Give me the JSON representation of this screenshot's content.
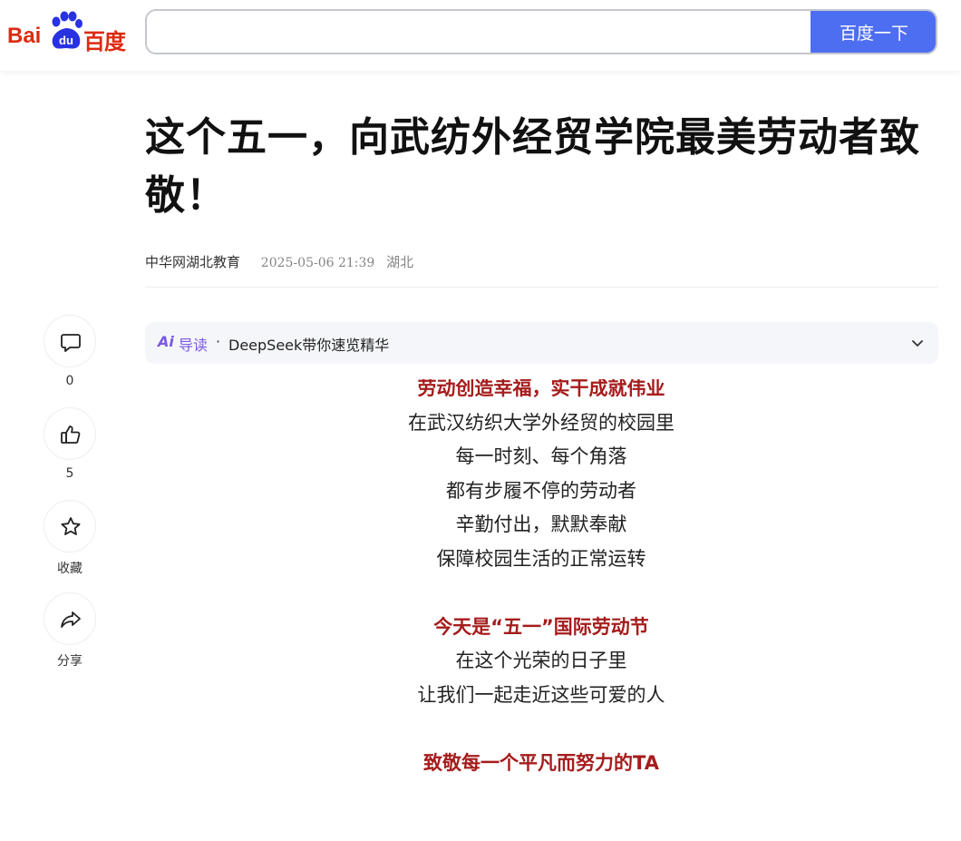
{
  "header": {
    "logo": {
      "text_left": "Bai",
      "text_mid": "du",
      "text_right": "百度"
    },
    "search": {
      "value": "",
      "button_label": "百度一下"
    }
  },
  "article": {
    "title": "这个五一，向武纺外经贸学院最美劳动者致敬！",
    "author": "中华网湖北教育",
    "date": "2025-05-06 21:39",
    "location": "湖北",
    "ai_summary": {
      "logo": "Ai",
      "label": "导读",
      "separator": "·",
      "text": "DeepSeek带你速览精华"
    },
    "lines": [
      {
        "text": "劳动创造幸福，实干成就伟业",
        "style": "red"
      },
      {
        "text": "在武汉纺织大学外经贸的校园里",
        "style": "normal"
      },
      {
        "text": "每一时刻、每个角落",
        "style": "normal"
      },
      {
        "text": "都有步履不停的劳动者",
        "style": "normal"
      },
      {
        "text": "辛勤付出，默默奉献",
        "style": "normal"
      },
      {
        "text": "保障校园生活的正常运转",
        "style": "normal"
      },
      {
        "text": "",
        "style": "blank"
      },
      {
        "text": "今天是“五一”国际劳动节",
        "style": "red"
      },
      {
        "text": "在这个光荣的日子里",
        "style": "normal"
      },
      {
        "text": "让我们一起走近这些可爱的人",
        "style": "normal"
      },
      {
        "text": "",
        "style": "blank"
      },
      {
        "text": "致敬每一个平凡而努力的TA",
        "style": "red"
      }
    ]
  },
  "side_actions": [
    {
      "icon": "comment-icon",
      "label": "0"
    },
    {
      "icon": "like-icon",
      "label": "5"
    },
    {
      "icon": "star-icon",
      "label": "收藏"
    },
    {
      "icon": "share-icon",
      "label": "分享"
    }
  ],
  "colors": {
    "brand_red": "#de2910",
    "search_button": "#4e6ef2",
    "ai_purple": "#7b58e6",
    "highlight_red": "#a61c1c"
  }
}
